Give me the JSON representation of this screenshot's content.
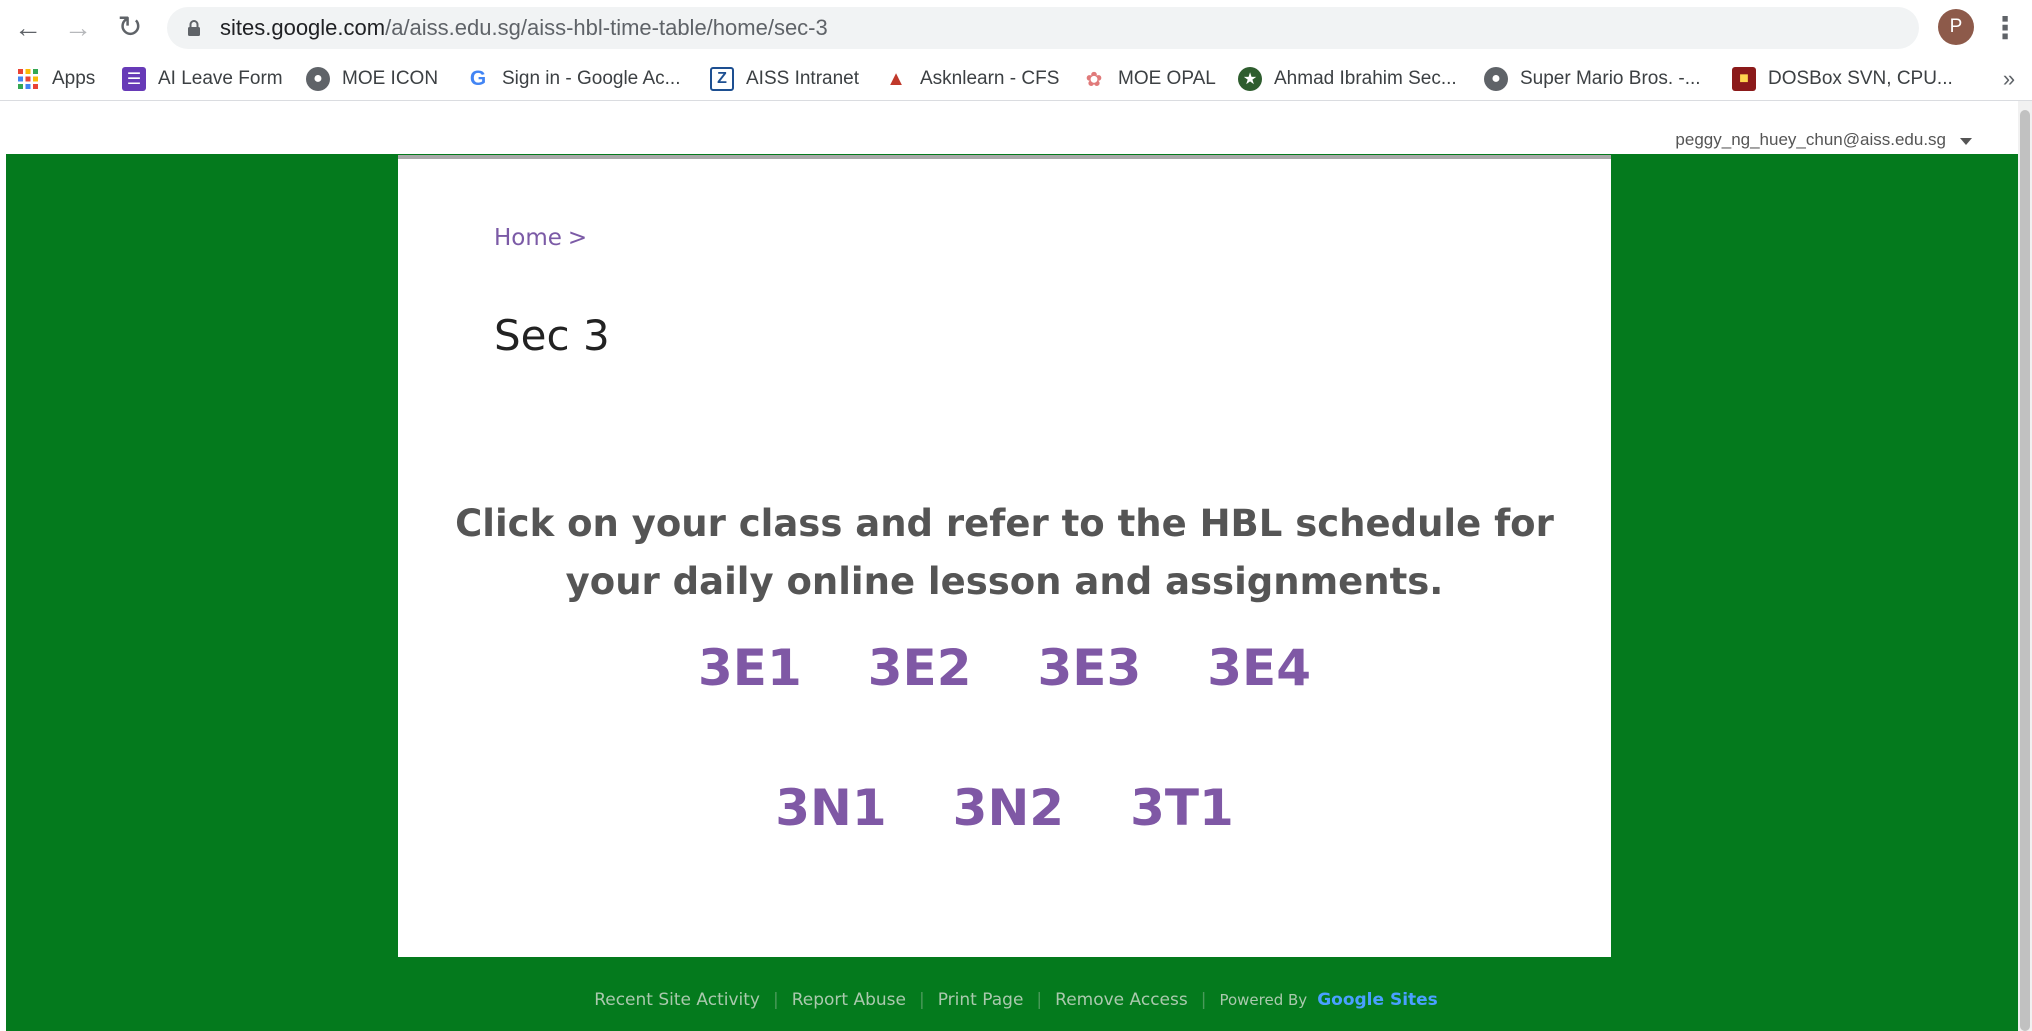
{
  "browser": {
    "url_host": "sites.google.com",
    "url_path": "/a/aiss.edu.sg/aiss-hbl-time-table/home/sec-3",
    "profile_initial": "P",
    "bookmarks": [
      {
        "label": "Apps",
        "icon": "apps-grid-icon"
      },
      {
        "label": "AI Leave Form",
        "icon": "forms-icon"
      },
      {
        "label": "MOE ICON",
        "icon": "globe-icon"
      },
      {
        "label": "Sign in - Google Ac...",
        "icon": "google-icon"
      },
      {
        "label": "AISS Intranet",
        "icon": "z-icon"
      },
      {
        "label": "Asknlearn - CFS",
        "icon": "asknlearn-icon"
      },
      {
        "label": "MOE OPAL",
        "icon": "opal-icon"
      },
      {
        "label": "Ahmad Ibrahim Sec...",
        "icon": "school-crest-icon"
      },
      {
        "label": "Super Mario Bros. -...",
        "icon": "globe-icon"
      },
      {
        "label": "DOSBox SVN, CPU...",
        "icon": "dosbox-icon"
      }
    ],
    "more_label": "»"
  },
  "site": {
    "user_email": "peggy_ng_huey_chun@aiss.edu.sg",
    "breadcrumb_home": "Home",
    "breadcrumb_sep": ">",
    "title": "Sec 3",
    "instruction_line1": "Click on your class and refer to the HBL schedule for",
    "instruction_line2": "your daily online lesson and assignments.",
    "classes_row1": [
      "3E1",
      "3E2",
      "3E3",
      "3E4"
    ],
    "classes_row2": [
      "3N1",
      "3N2",
      "3T1"
    ],
    "colors": {
      "background": "#047a1d",
      "link": "#7f58a5"
    }
  },
  "footer": {
    "recent": "Recent Site Activity",
    "report": "Report Abuse",
    "print": "Print Page",
    "remove": "Remove Access",
    "powered": "Powered By",
    "google_sites": "Google Sites"
  }
}
